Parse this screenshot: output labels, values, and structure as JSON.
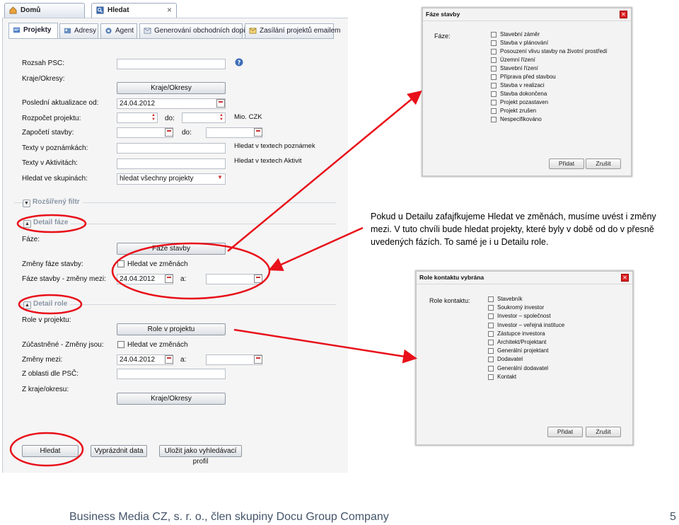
{
  "browser_tabs": [
    {
      "label": "Domů",
      "icon": "home-icon"
    },
    {
      "label": "Hledat",
      "icon": "search-icon",
      "close": "×"
    }
  ],
  "app_tabs": [
    {
      "label": "Projekty",
      "icon": "projects-icon"
    },
    {
      "label": "Adresy",
      "icon": "addresses-icon"
    },
    {
      "label": "Agent",
      "icon": "agent-icon"
    },
    {
      "label": "Generování obchodních dopisů",
      "icon": "letters-icon"
    },
    {
      "label": "Zasílání projektů emailem",
      "icon": "email-icon"
    }
  ],
  "form": {
    "rozsah_psc": {
      "label": "Rozsah PSC:"
    },
    "kraje_okresy": {
      "label": "Kraje/Okresy:",
      "button": "Kraje/Okresy"
    },
    "posledni_aktualizace": {
      "label": "Poslední aktualizace od:",
      "value": "24.04.2012"
    },
    "rozpocet": {
      "label": "Rozpočet projektu:",
      "do": "do:",
      "unit": "Mio. CZK"
    },
    "zapoceti": {
      "label": "Započetí stavby:",
      "do": "do:"
    },
    "texty_poznamky": {
      "label": "Texty v poznámkách:",
      "note": "Hledat v textech poznámek"
    },
    "texty_aktivity": {
      "label": "Texty v Aktivitách:",
      "note": "Hledat v textech Aktivit"
    },
    "skupiny": {
      "label": "Hledat ve skupinách:",
      "value": "hledat všechny projekty"
    },
    "rozsireny_filtr": "Rozšířený filtr",
    "detail_faze": {
      "title": "Detail fáze",
      "faze_label": "Fáze:",
      "faze_button": "Fáze stavby",
      "zmeny_label": "Změny fáze stavby:",
      "zmeny_check": "Hledat ve změnách",
      "mezi_label": "Fáze stavby - změny mezi:",
      "mezi_value": "24.04.2012",
      "a": "a:"
    },
    "detail_role": {
      "title": "Detail role",
      "role_label": "Role v projektu:",
      "role_button": "Role v projektu",
      "zucastnene_label": "Zúčastněné - Změny jsou:",
      "zucastnene_check": "Hledat ve změnách",
      "zmeny_label": "Změny mezi:",
      "zmeny_value": "24.04.2012",
      "a": "a:",
      "psc_label": "Z oblasti dle PSČ:",
      "kraj_label": "Z kraje/okresu:",
      "kraj_button": "Kraje/Okresy"
    },
    "buttons": {
      "search": "Hledat",
      "clear": "Vyprázdnit data",
      "save": "Uložit jako vyhledávací profil"
    }
  },
  "dialog_faze": {
    "title": "Fáze stavby",
    "label": "Fáze:",
    "options": [
      "Stavební záměr",
      "Stavba v plánování",
      "Posouzení vlivu stavby na životní prostředí",
      "Územní řízení",
      "Stavební řízení",
      "Příprava před stavbou",
      "Stavba v realizaci",
      "Stavba dokončena",
      "Projekt pozastaven",
      "Projekt zrušen",
      "Nespecifikováno"
    ],
    "ok": "Přidat",
    "cancel": "Zrušit"
  },
  "dialog_role": {
    "title": "Role kontaktu vybrána",
    "label": "Role kontaktu:",
    "options": [
      "Stavebník",
      "Soukromý investor",
      "Investor – společnost",
      "Investor – veřejná instituce",
      "Zástupce investora",
      "Architekt/Projektant",
      "Generální projektant",
      "Dodavatel",
      "Generální dodavatel",
      "Kontakt"
    ],
    "ok": "Přidat",
    "cancel": "Zrušit"
  },
  "annotation": "Pokud u Detailu zafajfkujeme Hledat ve změnách, musíme uvést i změny mezi. V tuto chvíli bude hledat projekty, které byly v době od do v přesně uvedených fázích. To samé je i u Detailu role.",
  "footer": "Business Media CZ, s. r. o., člen skupiny Docu Group Company",
  "page_number": "5",
  "colors": {
    "annotation_red": "#e8101a",
    "section_gray": "#8a96a6"
  }
}
